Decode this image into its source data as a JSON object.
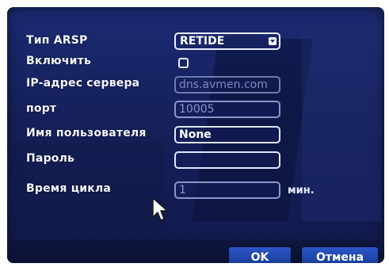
{
  "form": {
    "type_label": "Тип ARSP",
    "type_value": "RETIDE",
    "enable_label": "Включить",
    "enable_checked": false,
    "server_label": "IP-адрес сервера",
    "server_value": "dns.avmen.com",
    "port_label": "порт",
    "port_value": "10005",
    "username_label": "Имя пользователя",
    "username_value": "None",
    "password_label": "Пароль",
    "password_value": "",
    "cycle_label": "Время цикла",
    "cycle_value": "1",
    "cycle_unit": "мин."
  },
  "buttons": {
    "ok_label": "OK",
    "cancel_label": "Отмена"
  },
  "icons": {
    "cursor": "mouse-pointer-icon",
    "dropdown": "dropdown-arrow-icon"
  },
  "colors": {
    "panel": "#1b2b72",
    "button": "#2a56c8",
    "text": "#f4f6ff"
  }
}
